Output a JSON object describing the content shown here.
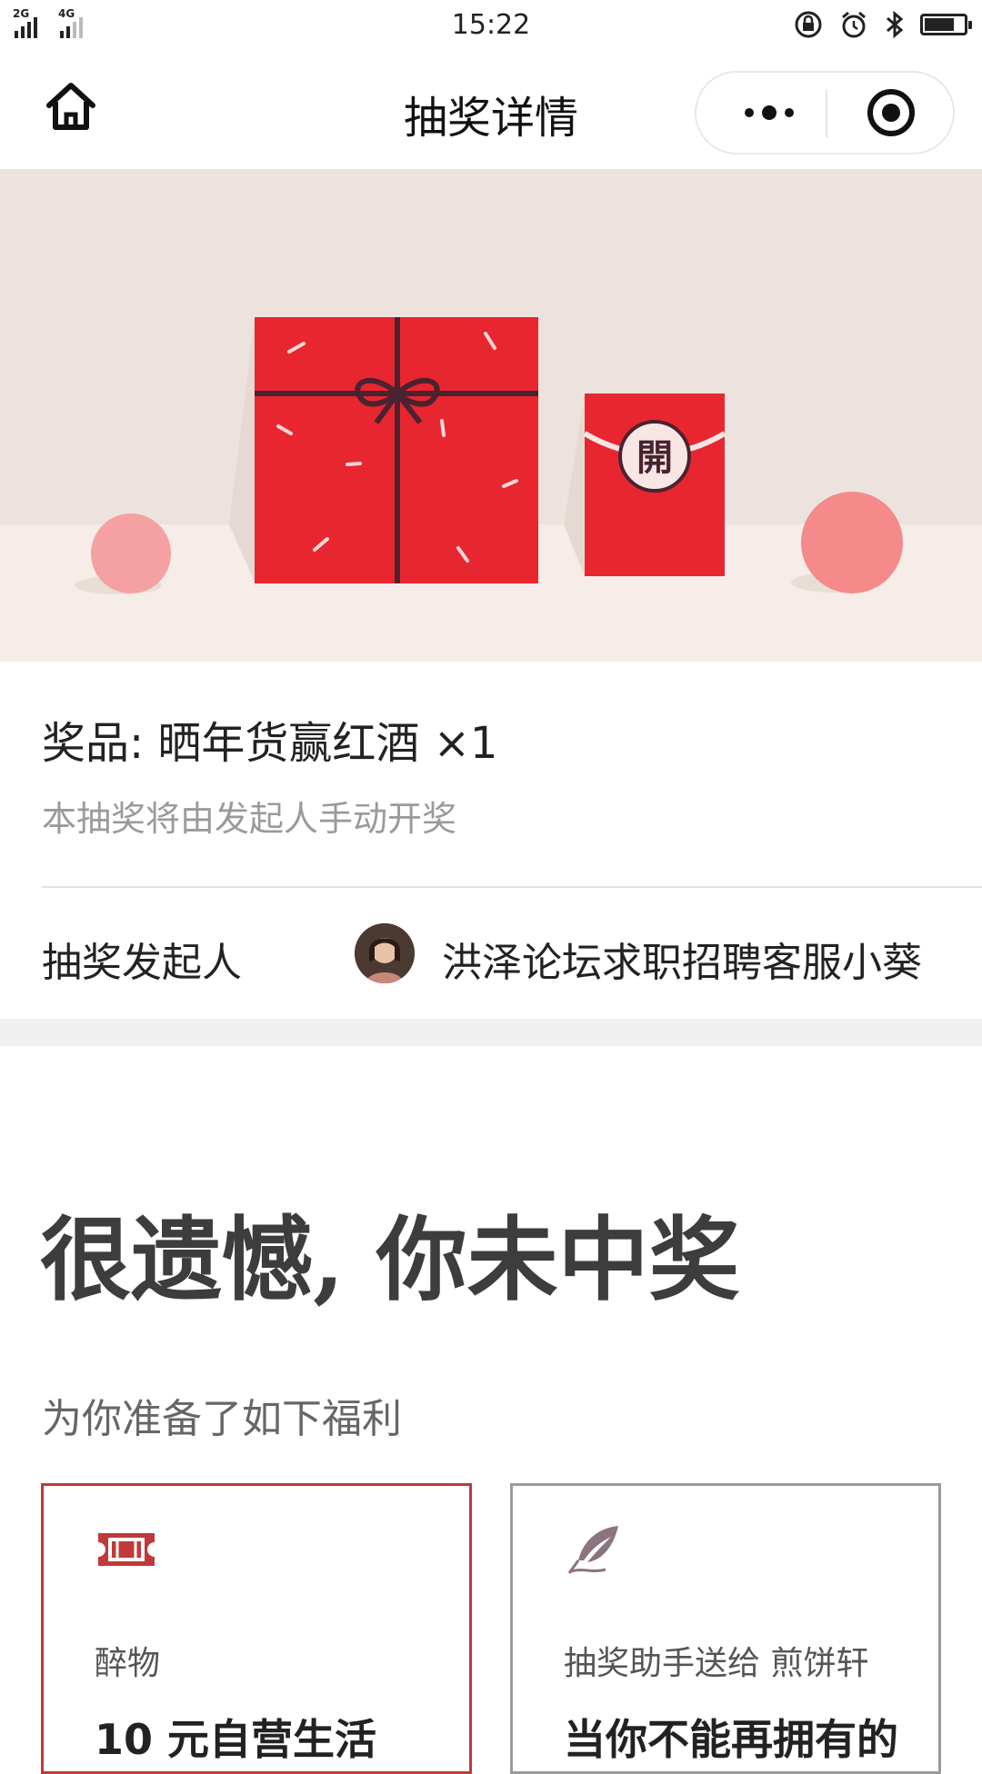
{
  "status_bar": {
    "signal_1": "2G",
    "signal_2": "4G",
    "time": "15:22",
    "icons": [
      "rotation-lock-icon",
      "alarm-icon",
      "bluetooth-icon",
      "battery-icon"
    ]
  },
  "navbar": {
    "title": "抽奖详情",
    "home_icon": "home-icon",
    "more_icon": "more-dots-icon",
    "close_icon": "target-close-icon"
  },
  "banner": {
    "red_packet_char": "開",
    "colors": {
      "gift": "#e8262f",
      "ribbon": "#4a2230",
      "ball": "#f48a8a",
      "bg": "#efe4df"
    }
  },
  "prize": {
    "title": "奖品: 晒年货赢红酒 ×1",
    "note": "本抽奖将由发起人手动开奖"
  },
  "initiator": {
    "label": "抽奖发起人",
    "name": "洪泽论坛求职招聘客服小葵"
  },
  "result": {
    "title": "很遗憾, 你未中奖",
    "welfare_label": "为你准备了如下福利"
  },
  "cards": [
    {
      "icon": "ticket-icon",
      "sub": "醉物",
      "name": "10 元自营生活",
      "accent": "#c0393b"
    },
    {
      "icon": "feather-icon",
      "sub": "抽奖助手送给 煎饼轩",
      "name": "当你不能再拥有的",
      "accent": "#9a9a9a"
    }
  ]
}
